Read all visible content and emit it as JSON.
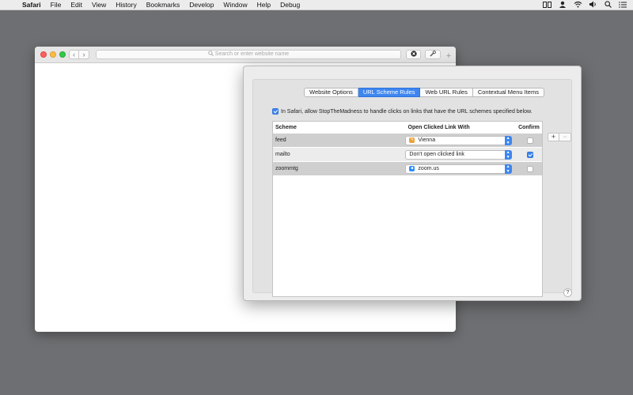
{
  "menubar": {
    "app": "Safari",
    "items": [
      "File",
      "Edit",
      "View",
      "History",
      "Bookmarks",
      "Develop",
      "Window",
      "Help",
      "Debug"
    ],
    "status_icons": [
      "split-view-icon",
      "user-icon",
      "wifi-icon",
      "volume-icon",
      "spotlight-search-icon",
      "notification-center-icon"
    ]
  },
  "safari": {
    "address_placeholder": "Search or enter website name",
    "back_glyph": "‹",
    "forward_glyph": "›",
    "newtab_glyph": "+"
  },
  "prefs": {
    "tabs": [
      {
        "label": "Website Options",
        "active": false
      },
      {
        "label": "URL Scheme Rules",
        "active": true
      },
      {
        "label": "Web URL Rules",
        "active": false
      },
      {
        "label": "Contextual Menu Items",
        "active": false
      }
    ],
    "allow_text": "In Safari, allow StopTheMadness to handle clicks on links that have the URL schemes specified below.",
    "allow_checked": true,
    "table": {
      "headers": {
        "scheme": "Scheme",
        "open": "Open Clicked Link With",
        "confirm": "Confirm"
      },
      "rows": [
        {
          "scheme": "feed",
          "app": "Vienna",
          "app_icon": "vienna-app-icon",
          "confirm": false
        },
        {
          "scheme": "mailto",
          "app": "Don't open clicked link",
          "app_icon": "",
          "confirm": true
        },
        {
          "scheme": "zoommtg",
          "app": "zoom.us",
          "app_icon": "zoom-app-icon",
          "confirm": false
        }
      ]
    },
    "plus_label": "+",
    "minus_label": "−",
    "help_label": "?"
  },
  "colors": {
    "accent": "#3d86f0",
    "desktop": "#6e6f72"
  }
}
